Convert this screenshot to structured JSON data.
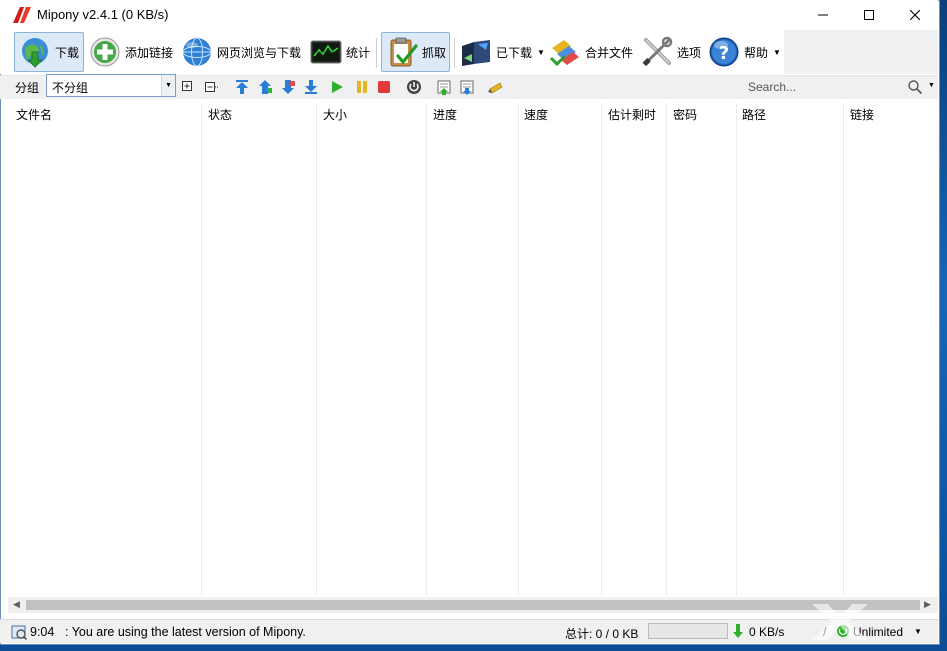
{
  "window": {
    "title": "Mipony v2.4.1 (0 KB/s)",
    "controls": [
      "minimize",
      "maximize",
      "close"
    ]
  },
  "toolbar": {
    "buttons": [
      {
        "id": "download",
        "label": "下载",
        "icon": "download-globe-icon",
        "active": true
      },
      {
        "id": "add-link",
        "label": "添加链接",
        "icon": "add-plus-icon",
        "active": false
      },
      {
        "id": "browse",
        "label": "网页浏览与下载",
        "icon": "globe-icon",
        "active": false
      },
      {
        "id": "stats",
        "label": "统计",
        "icon": "stats-monitor-icon",
        "active": false
      },
      {
        "id": "capture",
        "label": "抓取",
        "icon": "clipboard-check-icon",
        "active": true
      },
      {
        "id": "downloaded",
        "label": "已下载",
        "icon": "downloaded-folder-icon",
        "active": false,
        "dropdown": true
      },
      {
        "id": "merge",
        "label": "合并文件",
        "icon": "merge-files-icon",
        "active": false
      },
      {
        "id": "options",
        "label": "选项",
        "icon": "tools-icon",
        "active": false
      },
      {
        "id": "help",
        "label": "帮助",
        "icon": "help-icon",
        "active": false,
        "dropdown": true
      }
    ]
  },
  "groupbar": {
    "label": "分组",
    "selected": "不分组",
    "icons": [
      "expand-icon",
      "collapse-icon",
      "move-top-icon",
      "move-up-icon",
      "move-down-icon",
      "move-bottom-icon",
      "play-icon",
      "pause-icon",
      "stop-icon",
      "power-icon",
      "import-icon",
      "export-icon",
      "clean-icon"
    ]
  },
  "search": {
    "placeholder": "Search..."
  },
  "columns": [
    "文件名",
    "状态",
    "大小",
    "进度",
    "速度",
    "估计剩时",
    "密码",
    "路径",
    "链接"
  ],
  "statusbar": {
    "time": "9:04",
    "message": ": You are using the latest version of Mipony.",
    "total": "总计: 0 / 0 KB",
    "progress": 0,
    "speed": "0 KB/s",
    "slash": "/",
    "limit": "Unlimited"
  },
  "colors": {
    "accent": "#06b025",
    "active_button": "#dce9f6",
    "desktop": "#1467b8"
  }
}
